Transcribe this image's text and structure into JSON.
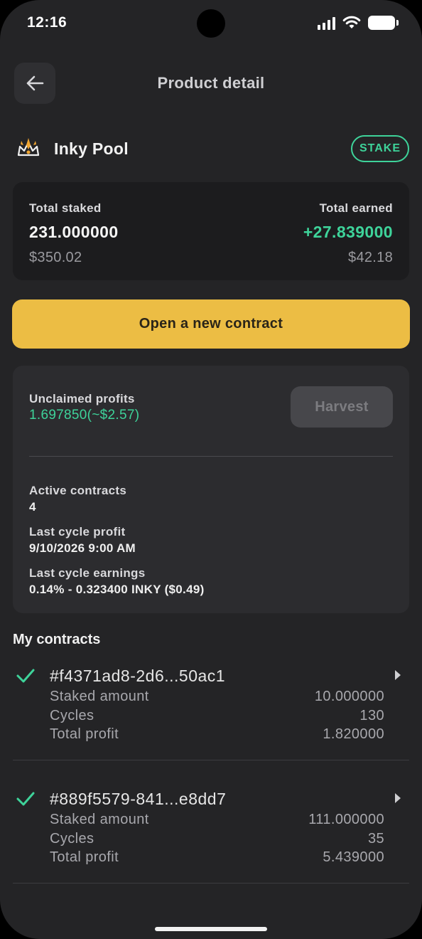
{
  "status_bar": {
    "time": "12:16"
  },
  "header": {
    "title": "Product detail"
  },
  "product": {
    "name": "Inky Pool",
    "badge": "STAKE"
  },
  "totals": {
    "staked_label": "Total staked",
    "staked_value": "231.000000",
    "staked_usd": "$350.02",
    "earned_label": "Total earned",
    "earned_value": "+27.839000",
    "earned_usd": "$42.18"
  },
  "actions": {
    "open_contract_label": "Open a new contract"
  },
  "profits": {
    "unclaimed_label": "Unclaimed profits",
    "unclaimed_value": "1.697850(~$2.57)",
    "harvest_label": "Harvest",
    "active_label": "Active contracts",
    "active_value": "4",
    "last_cycle_profit_label": "Last cycle profit",
    "last_cycle_profit_value": "9/10/2026 9:00 AM",
    "last_cycle_earnings_label": "Last cycle earnings",
    "last_cycle_earnings_value": "0.14% - 0.323400 INKY ($0.49)"
  },
  "contracts": {
    "title": "My contracts",
    "items": [
      {
        "id": "#f4371ad8-2d6...50ac1",
        "staked_label": "Staked amount",
        "staked_value": "10.000000",
        "cycles_label": "Cycles",
        "cycles_value": "130",
        "profit_label": "Total profit",
        "profit_value": "1.820000"
      },
      {
        "id": "#889f5579-841...e8dd7",
        "staked_label": "Staked amount",
        "staked_value": "111.000000",
        "cycles_label": "Cycles",
        "cycles_value": "35",
        "profit_label": "Total profit",
        "profit_value": "5.439000"
      }
    ]
  },
  "colors": {
    "accent": "#ecbd44",
    "positive": "#3ed39a",
    "background": "#242426"
  }
}
